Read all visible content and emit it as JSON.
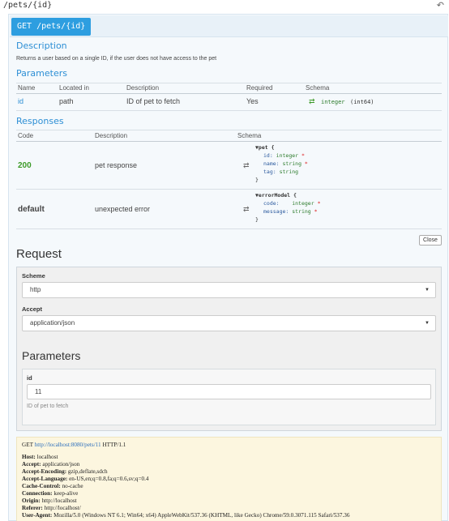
{
  "topbar": {
    "path": "/pets/{id}",
    "back_icon": "↶"
  },
  "operation": {
    "method_path": "GET /pets/{id}",
    "description_title": "Description",
    "description": "Returns a user based on a single ID, if the user does not have access to the pet"
  },
  "parameters": {
    "title": "Parameters",
    "headers": [
      "Name",
      "Located in",
      "Description",
      "Required",
      "Schema"
    ],
    "rows": [
      {
        "name": "id",
        "located_in": "path",
        "description": "ID of pet to fetch",
        "required": "Yes",
        "schema_icon": "⇄",
        "schema_type": "integer",
        "schema_format": "(int64)"
      }
    ]
  },
  "responses": {
    "title": "Responses",
    "headers": [
      "Code",
      "Description",
      "Schema"
    ],
    "rows": [
      {
        "code": "200",
        "description": "pet response",
        "schema_icon": "⇄",
        "model": "pet {",
        "fields": [
          {
            "key": "id:",
            "type": "integer",
            "req": "*"
          },
          {
            "key": "name:",
            "type": "string",
            "req": "*"
          },
          {
            "key": "tag:",
            "type": "string",
            "req": ""
          }
        ],
        "close": "}"
      },
      {
        "code": "default",
        "description": "unexpected error",
        "schema_icon": "⇄",
        "model": "errorModel {",
        "fields": [
          {
            "key": "code:",
            "type": "integer",
            "req": "*"
          },
          {
            "key": "message:",
            "type": "string",
            "req": "*"
          }
        ],
        "close": "}"
      }
    ]
  },
  "close_button": "Close",
  "request": {
    "title": "Request",
    "scheme_label": "Scheme",
    "scheme_value": "http",
    "accept_label": "Accept",
    "accept_value": "application/json",
    "params_title": "Parameters",
    "param_label": "id",
    "param_value": "11",
    "param_hint": "ID of pet to fetch"
  },
  "http": {
    "request_line_prefix": "GET ",
    "request_url": "http://localhost:8080/pets/11",
    "request_line_suffix": " HTTP/1.1",
    "headers": [
      {
        "k": "Host:",
        "v": " localhost"
      },
      {
        "k": "Accept:",
        "v": " application/json"
      },
      {
        "k": "Accept-Encoding:",
        "v": " gzip,deflate,sdch"
      },
      {
        "k": "Accept-Language:",
        "v": " en-US,en;q=0.8,fa;q=0.6,sv;q=0.4"
      },
      {
        "k": "Cache-Control:",
        "v": " no-cache"
      },
      {
        "k": "Connection:",
        "v": " keep-alive"
      },
      {
        "k": "Origin:",
        "v": " http://localhost"
      },
      {
        "k": "Referer:",
        "v": " http://localhost/"
      },
      {
        "k": "User-Agent:",
        "v": " Mozilla/5.0 (Windows NT 6.1; Win64; x64) AppleWebKit/537.36 (KHTML, like Gecko) Chrome/59.0.3071.115 Safari/537.36"
      }
    ]
  }
}
